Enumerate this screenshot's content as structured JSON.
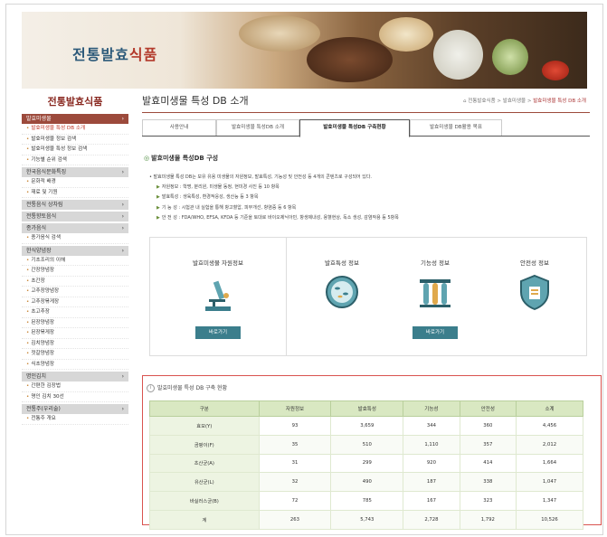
{
  "banner": {
    "title_blue": "전통발효",
    "title_red": "식품"
  },
  "sidebar": {
    "title": "전통발효식품",
    "items": [
      {
        "type": "group",
        "label": "발효미생물",
        "active": true
      },
      {
        "type": "item",
        "label": "발효미생물 특성 DB 소개",
        "active": true
      },
      {
        "type": "item",
        "label": "발효미생물 정보 검색"
      },
      {
        "type": "item",
        "label": "발효미생물 특성 정보 검색"
      },
      {
        "type": "item",
        "label": "기능별 순위 검색"
      },
      {
        "type": "group",
        "label": "한국음식문화특징"
      },
      {
        "type": "item",
        "label": "문화적 배경"
      },
      {
        "type": "item",
        "label": "재료 및 기원"
      },
      {
        "type": "group",
        "label": "전통음식 상차림"
      },
      {
        "type": "group",
        "label": "전통향토음식"
      },
      {
        "type": "group",
        "label": "종가음식"
      },
      {
        "type": "item",
        "label": "종가음식 검색"
      },
      {
        "type": "group",
        "label": "한식양념장"
      },
      {
        "type": "item",
        "label": "기초조리의 이해"
      },
      {
        "type": "item",
        "label": "간장양념장"
      },
      {
        "type": "item",
        "label": "초간장"
      },
      {
        "type": "item",
        "label": "고추장양념장"
      },
      {
        "type": "item",
        "label": "고추장볶게장"
      },
      {
        "type": "item",
        "label": "초고추장"
      },
      {
        "type": "item",
        "label": "된장양념장"
      },
      {
        "type": "item",
        "label": "된장볶게장"
      },
      {
        "type": "item",
        "label": "김치양념장"
      },
      {
        "type": "item",
        "label": "젓갈양념장"
      },
      {
        "type": "item",
        "label": "식초양념장"
      },
      {
        "type": "group",
        "label": "명인김치"
      },
      {
        "type": "item",
        "label": "간편한 김장법"
      },
      {
        "type": "item",
        "label": "명인 김치 30선"
      },
      {
        "type": "group",
        "label": "전통주(우리술)"
      },
      {
        "type": "item",
        "label": "전통주 개요"
      }
    ]
  },
  "main": {
    "title": "발효미생물 특성 DB 소개",
    "breadcrumb": {
      "home": "전통발효식품",
      "mid": "발효미생물",
      "current": "발효미생물 특성 DB 소개"
    },
    "tabs": [
      {
        "label": "사용안내"
      },
      {
        "label": "발효미생물 특성DB 소개"
      },
      {
        "label": "발효미생물 특성DB 구축현황",
        "active": true
      },
      {
        "label": "발효미생물 DB활용 목표"
      }
    ],
    "section_title": "발효미생물 특성DB 구성",
    "desc_intro": "발효미생물 특성 DB는 보유 유용 미생물의 자원정보, 발효특성, 기능성 및 안전성 등 4개의 콘텐츠로 구성되어 있다.",
    "desc_items": [
      "자원정보 : 학명, 분리원, 미생물 동정, 현미경 사진 등 10 항목",
      "발효특성 : 생육특성, 환경적응성, 생산능 등 3 항목",
      "기 능 성 : 시험관 내 실험을 통해 항고혈압, 피부개선, 항염증 등 6 항목",
      "안 전 성 : FDA/WHO, EFSA, KFDA 등 기준을 토대로 바이오제닉아민, 항생제내성, 용혈현상, 독소 생성, 감염작용 등 5항목"
    ],
    "cards": {
      "resource": "발효미생물 자원정보",
      "fermentation": "발효특성 정보",
      "function": "기능성 정보",
      "safety": "안전성 정보",
      "button": "바로가기"
    }
  },
  "status": {
    "title": "발효미생물 특성 DB 구축 현황",
    "headers": [
      "구분",
      "자원정보",
      "발효특성",
      "기능성",
      "안전성",
      "소계"
    ],
    "rows": [
      [
        "효모(Y)",
        "93",
        "3,659",
        "344",
        "360",
        "4,456"
      ],
      [
        "곰팡이(F)",
        "35",
        "510",
        "1,110",
        "357",
        "2,012"
      ],
      [
        "초산균(A)",
        "31",
        "299",
        "920",
        "414",
        "1,664"
      ],
      [
        "유산균(L)",
        "32",
        "490",
        "187",
        "338",
        "1,047"
      ],
      [
        "바실러스균(B)",
        "72",
        "785",
        "167",
        "323",
        "1,347"
      ],
      [
        "계",
        "263",
        "5,743",
        "2,728",
        "1,792",
        "10,526"
      ]
    ]
  },
  "colors": {
    "accent": "#9c4a3c",
    "link": "#c0392b",
    "button": "#3b7e8c",
    "table_header": "#d9e8c2",
    "highlight_border": "#d9534f"
  }
}
